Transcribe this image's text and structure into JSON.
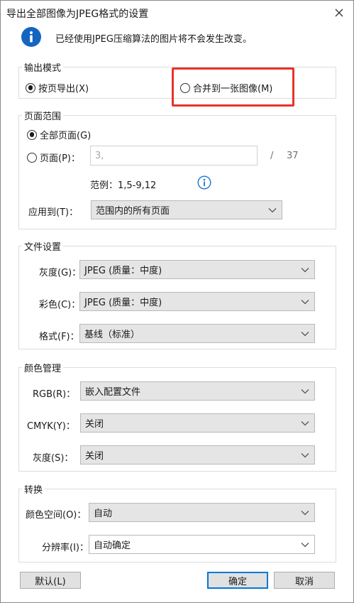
{
  "window": {
    "title": "导出全部图像为JPEG格式的设置"
  },
  "info": {
    "text": "已经使用JPEG压缩算法的图片将不会发生改变。"
  },
  "output_mode": {
    "title": "输出模式",
    "options": [
      {
        "label": "按页导出(X)",
        "checked": true
      },
      {
        "label": "合并到一张图像(M)",
        "checked": false
      }
    ]
  },
  "page_range": {
    "title": "页面范围",
    "all_pages_label": "全部页面(G)",
    "pages_label": "页面(P)：",
    "pages_value": "3,",
    "separator": "/",
    "total_pages": "37",
    "example": "范例：1,5-9,12",
    "apply_label": "应用到(T)：",
    "apply_value": "范围内的所有页面"
  },
  "file_settings": {
    "title": "文件设置",
    "gray_label": "灰度(G)：",
    "gray_value": "JPEG (质量：中度)",
    "color_label": "彩色(C)：",
    "color_value": "JPEG (质量：中度)",
    "format_label": "格式(F)：",
    "format_value": "基线（标准）"
  },
  "color_management": {
    "title": "颜色管理",
    "rgb_label": "RGB(R)：",
    "rgb_value": "嵌入配置文件",
    "cmyk_label": "CMYK(Y)：",
    "cmyk_value": "关闭",
    "gray_label": "灰度(S)：",
    "gray_value": "关闭"
  },
  "conversion": {
    "title": "转换",
    "colorspace_label": "颜色空间(O)：",
    "colorspace_value": "自动",
    "resolution_label": "分辨率(I)：",
    "resolution_value": "自动确定"
  },
  "buttons": {
    "default": "默认(L)",
    "ok": "确定",
    "cancel": "取消"
  },
  "colors": {
    "accent": "#0078d7",
    "highlight": "#e8332a",
    "info_icon": "#1565c0"
  },
  "icons": {
    "close": "close-icon",
    "info": "info-icon",
    "hint": "info-circle-icon",
    "dropdown": "chevron-down-icon"
  }
}
